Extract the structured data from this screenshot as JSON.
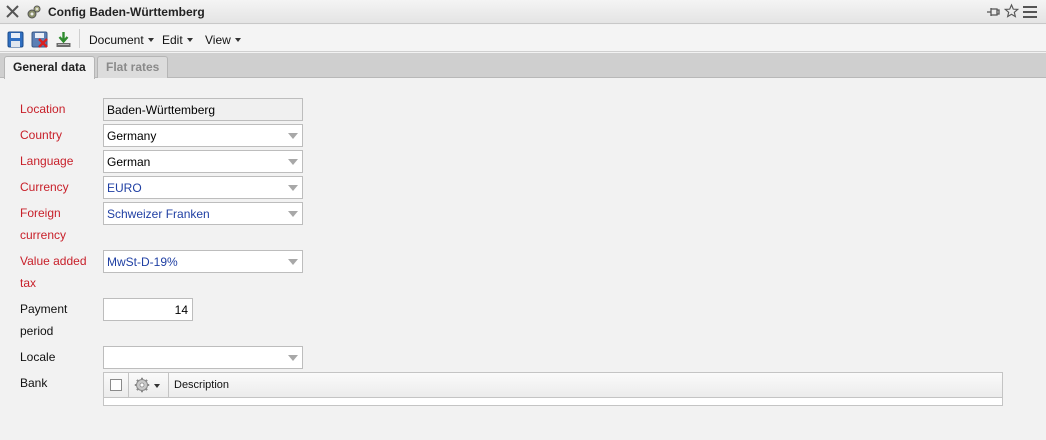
{
  "window": {
    "title": "Config Baden-Württemberg",
    "icons": [
      "close-icon",
      "config-icon",
      "pin-icon",
      "star-icon",
      "menu-icon"
    ]
  },
  "toolbar": {
    "icons": [
      "save-icon",
      "delete-icon",
      "download-icon"
    ],
    "menus": {
      "document": "Document",
      "edit": "Edit",
      "view": "View"
    }
  },
  "tabs": {
    "general": "General data",
    "flat_rates": "Flat rates"
  },
  "form": {
    "location": {
      "label": "Location",
      "value": "Baden-Württemberg"
    },
    "country": {
      "label": "Country",
      "value": "Germany"
    },
    "language": {
      "label": "Language",
      "value": "German"
    },
    "currency": {
      "label": "Currency",
      "value": "EURO"
    },
    "foreign_currency": {
      "label_line1": "Foreign",
      "label_line2": "currency",
      "value": "Schweizer Franken"
    },
    "vat": {
      "label_line1": "Value added",
      "label_line2": "tax",
      "value": "MwSt-D-19%"
    },
    "payment_period": {
      "label_line1": "Payment",
      "label_line2": "period",
      "value": "14"
    },
    "locale": {
      "label": "Locale",
      "value": ""
    },
    "bank": {
      "label": "Bank",
      "column_description": "Description"
    }
  },
  "colors": {
    "required_label": "#c8202a",
    "link_value": "#1f3fa3"
  }
}
